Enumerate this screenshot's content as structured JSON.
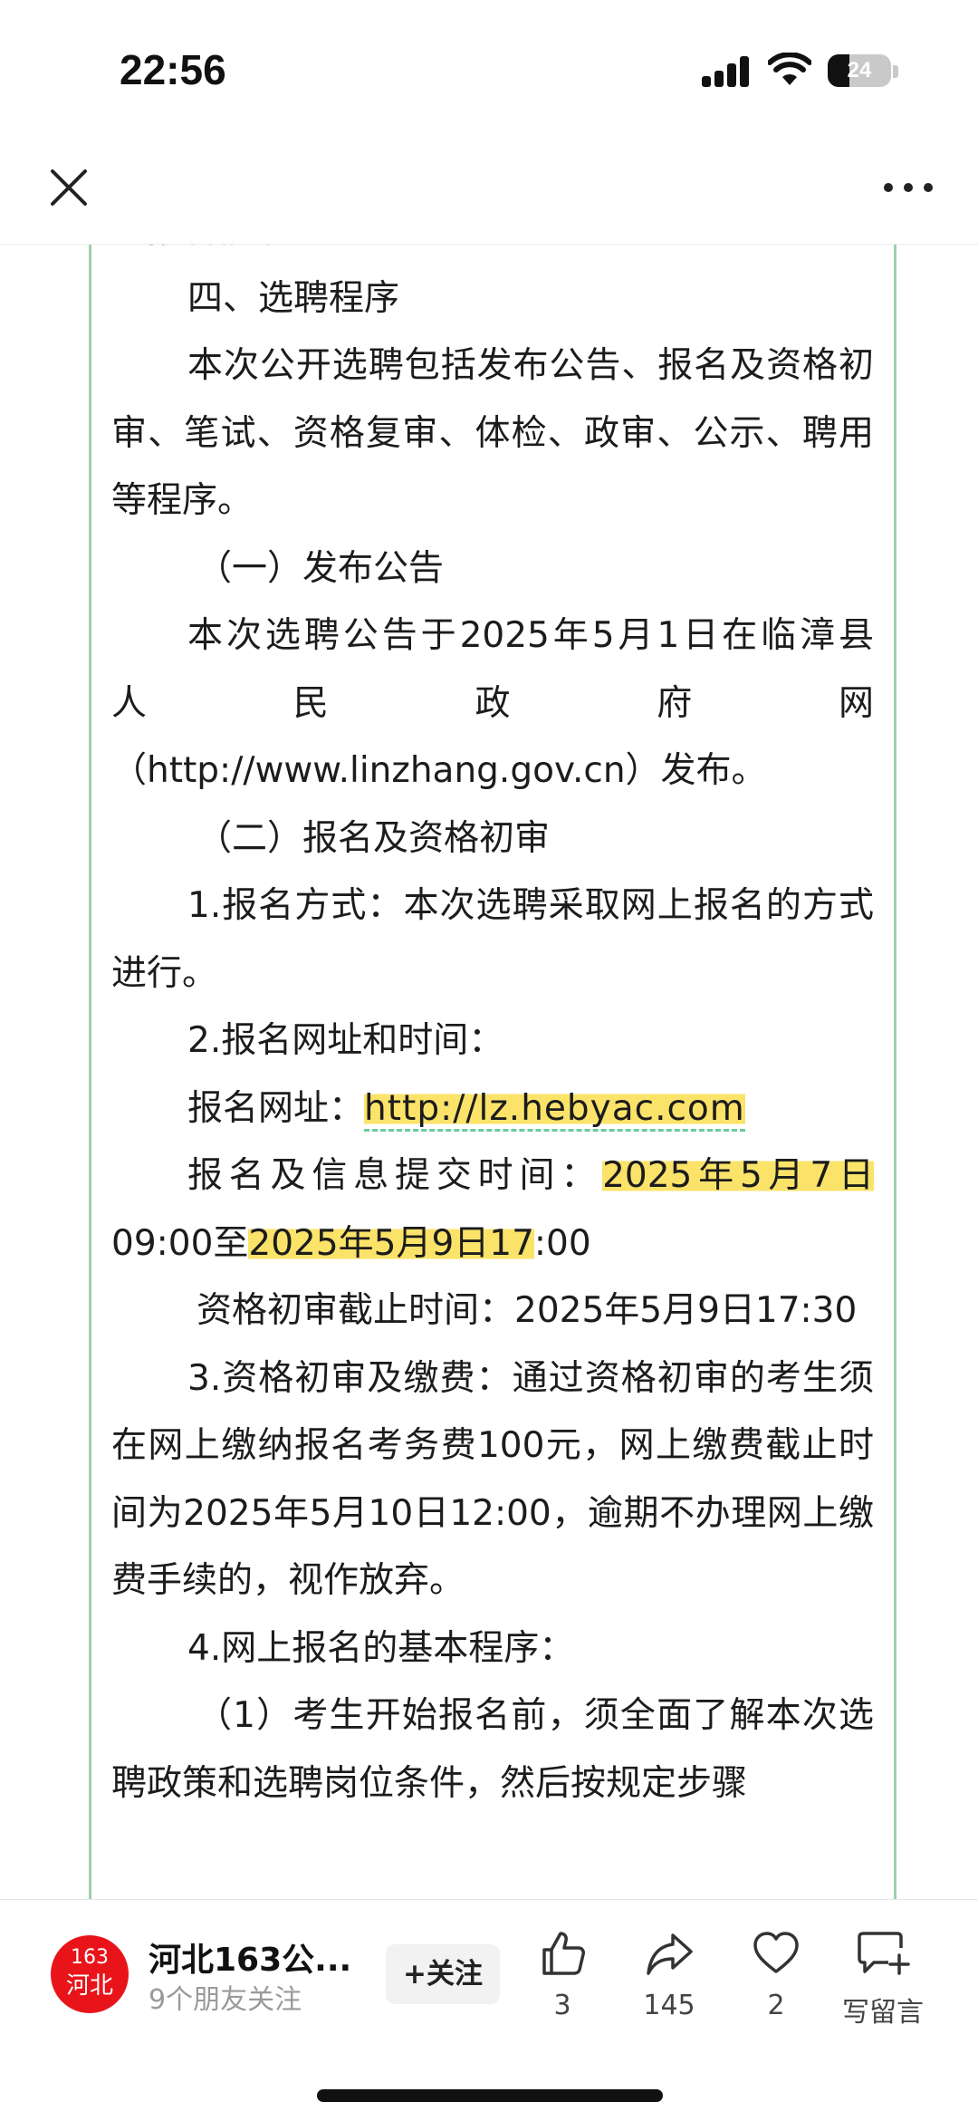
{
  "status_bar": {
    "time": "22:56",
    "battery": "24"
  },
  "article": {
    "paragraphs": [
      {
        "text": "待报名情形。",
        "style": "normal"
      },
      {
        "text": "四、选聘程序",
        "style": "indent"
      },
      {
        "text": "本次公开选聘包括发布公告、报名及资格初审、笔试、资格复审、体检、政审、公示、聘用等程序。",
        "style": "indent"
      },
      {
        "text": "（一）发布公告",
        "style": "indent"
      },
      {
        "text": "本次选聘公告于2025年5月1日在临漳县",
        "style": "indent"
      },
      {
        "text": "人民政府网",
        "style": "spread"
      },
      {
        "text": "（http://www.linzhang.gov.cn）发布。",
        "style": "normal"
      },
      {
        "text": "（二）报名及资格初审",
        "style": "indent"
      },
      {
        "text": "1.报名方式：本次选聘采取网上报名的方式进行。",
        "style": "indent"
      },
      {
        "text": "2.报名网址和时间：",
        "style": "indent"
      }
    ],
    "reg_url_label": "报名网址：",
    "reg_url": "http://lz.hebyac.com",
    "submit_label": "报名及信息提交时间：",
    "submit_start_date": "2025年5月7日",
    "submit_start_time": "09:00至",
    "submit_end_hl": "2025年5月9日17",
    "submit_end_rest": ":00",
    "paragraphs2": [
      {
        "text": "资格初审截止时间：2025年5月9日17:30",
        "style": "indent-s"
      },
      {
        "text": "3.资格初审及缴费：通过资格初审的考生须在网上缴纳报名考务费100元，网上缴费截止时间为2025年5月10日12:00，逾期不办理网上缴费手续的，视作放弃。",
        "style": "indent"
      },
      {
        "text": "4.网上报名的基本程序：",
        "style": "indent"
      },
      {
        "text": "（1）考生开始报名前，须全面了解本次选聘政策和选聘岗位条件，然后按规定步骤",
        "style": "indent"
      }
    ]
  },
  "bottom_bar": {
    "avatar_line1": "163",
    "avatar_line2": "河北",
    "account_name": "河北163公...",
    "account_sub": "9个朋友关注",
    "follow_label": "+关注",
    "like_count": "3",
    "share_count": "145",
    "heart_count": "2",
    "comment_label": "写留言"
  },
  "icons": {
    "close": "close-icon",
    "more": "more-icon",
    "like": "thumbs-up-icon",
    "share": "share-arrow-icon",
    "heart": "heart-icon",
    "comment": "comment-plus-icon"
  }
}
